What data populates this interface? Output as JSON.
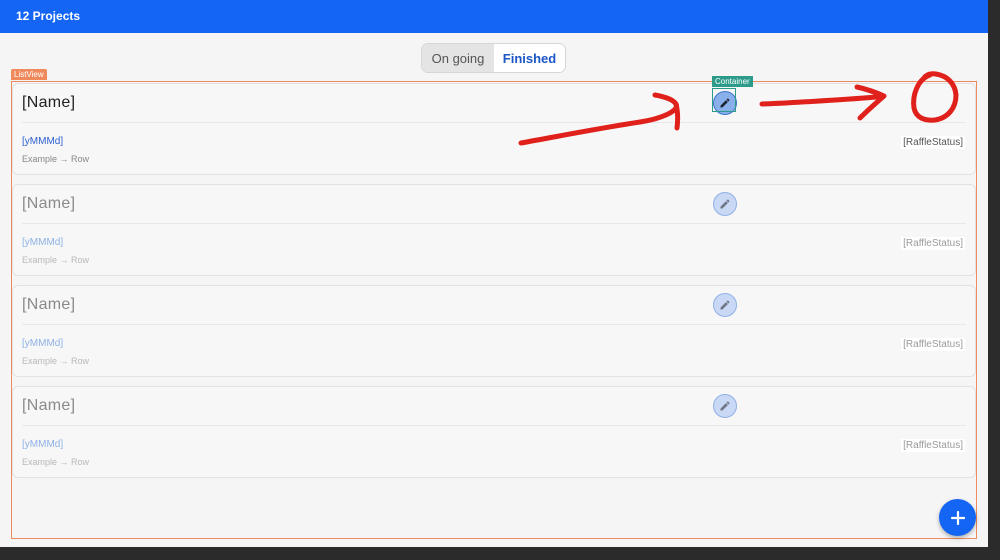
{
  "header": {
    "title": "12 Projects"
  },
  "tabs": {
    "ongoing_label": "On going",
    "finished_label": "Finished",
    "selected": "Finished"
  },
  "overlays": {
    "listview_label": "ListView",
    "container_label": "Container"
  },
  "items": [
    {
      "name": "[Name]",
      "date": "[yMMMd]",
      "status": "[RaffleStatus]",
      "route_from": "Example",
      "route_to": "Row"
    },
    {
      "name": "[Name]",
      "date": "[yMMMd]",
      "status": "[RaffleStatus]",
      "route_from": "Example",
      "route_to": "Row"
    },
    {
      "name": "[Name]",
      "date": "[yMMMd]",
      "status": "[RaffleStatus]",
      "route_from": "Example",
      "route_to": "Row"
    },
    {
      "name": "[Name]",
      "date": "[yMMMd]",
      "status": "[RaffleStatus]",
      "route_from": "Example",
      "route_to": "Row"
    }
  ],
  "colors": {
    "primary": "#1565f5",
    "annotation": "#e0201a",
    "listview_outline": "#f08a5d",
    "container_outline": "#2d9b8a"
  },
  "icons": {
    "edit": "pencil-icon",
    "add": "plus-icon",
    "route_arrow": "arrow-right-icon"
  }
}
